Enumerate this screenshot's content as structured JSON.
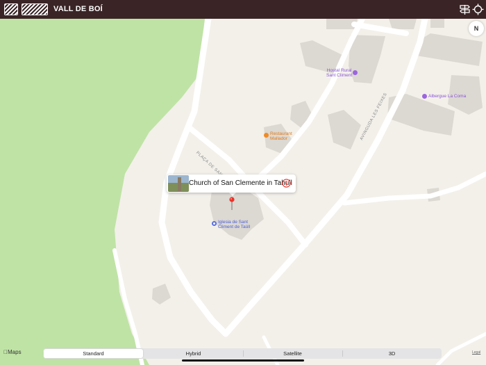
{
  "header": {
    "title": "VALL DE BOÍ",
    "background": "#3a2426"
  },
  "map": {
    "compass_label": "N",
    "callout_title": "Church of San Clemente in Tahull",
    "pois": [
      {
        "name": "Hostal Rural Sant Climent",
        "line1": "Hostal Rural",
        "line2": "Sant Climent",
        "color": "#9b64e0"
      },
      {
        "name": "Albergue La Coma",
        "line1": "Albergue La Coma",
        "line2": "",
        "color": "#9b64e0"
      },
      {
        "name": "Restaurant Mallador",
        "line1": "Restaurant",
        "line2": "Mallador",
        "color": "#f08a24"
      },
      {
        "name": "Iglesia de Sant Climent de Taüll",
        "line1": "Iglesia de Sant",
        "line2": "Climent de Taüll",
        "color": "#5b6fe0"
      }
    ],
    "road_labels": [
      "PLAÇA DE SANT CLIMENT",
      "AVINGUDA LES FEIXES"
    ],
    "colors": {
      "land": "#f3f0ea",
      "park": "#bfe3a5",
      "road": "#ffffff",
      "building": "#dcd8d2",
      "pin": "#e8352b"
    }
  },
  "footer": {
    "maps_logo": "Maps",
    "legal": "Legal",
    "map_types": [
      {
        "label": "Standard",
        "selected": true
      },
      {
        "label": "Hybrid",
        "selected": false
      },
      {
        "label": "Satellite",
        "selected": false
      },
      {
        "label": "3D",
        "selected": false
      }
    ]
  }
}
